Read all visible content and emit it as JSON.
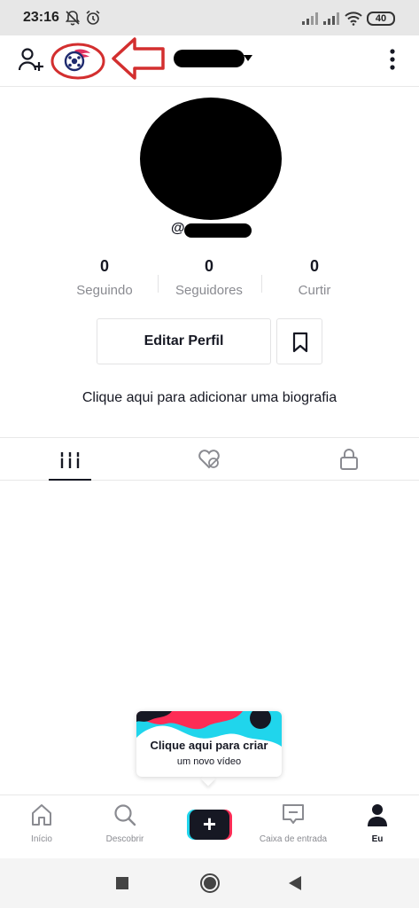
{
  "status_bar": {
    "time": "23:16",
    "battery": "40",
    "icons": [
      "bell-off-icon",
      "alarm-icon",
      "signal-icon",
      "signal-icon",
      "wifi-icon",
      "battery-icon"
    ]
  },
  "top_bar": {
    "icons": [
      "add-user-icon",
      "profile-badge-icon",
      "more-vertical-icon"
    ],
    "annotation_color": "#d32f2f"
  },
  "profile": {
    "handle_prefix": "@"
  },
  "stats": [
    {
      "value": "0",
      "label": "Seguindo"
    },
    {
      "value": "0",
      "label": "Seguidores"
    },
    {
      "value": "0",
      "label": "Curtir"
    }
  ],
  "actions": {
    "edit_profile": "Editar Perfil",
    "bookmark_icon": "bookmark-icon"
  },
  "bio_prompt": "Clique aqui para adicionar uma biografia",
  "tabs": [
    {
      "icon": "grid-icon",
      "active": true
    },
    {
      "icon": "liked-hidden-icon",
      "active": false
    },
    {
      "icon": "lock-icon",
      "active": false
    }
  ],
  "create_card": {
    "title": "Clique aqui para criar",
    "subtitle": "um novo vídeo"
  },
  "bottom_nav": [
    {
      "label": "Início",
      "icon": "home-icon"
    },
    {
      "label": "Descobrir",
      "icon": "search-icon"
    },
    {
      "label": "",
      "icon": "plus-icon"
    },
    {
      "label": "Caixa de entrada",
      "icon": "inbox-icon"
    },
    {
      "label": "Eu",
      "icon": "profile-icon",
      "active": true
    }
  ],
  "colors": {
    "brand_red": "#fe2c55",
    "brand_cyan": "#20d5ec",
    "text_primary": "#161823",
    "text_secondary": "#8a8b91"
  }
}
